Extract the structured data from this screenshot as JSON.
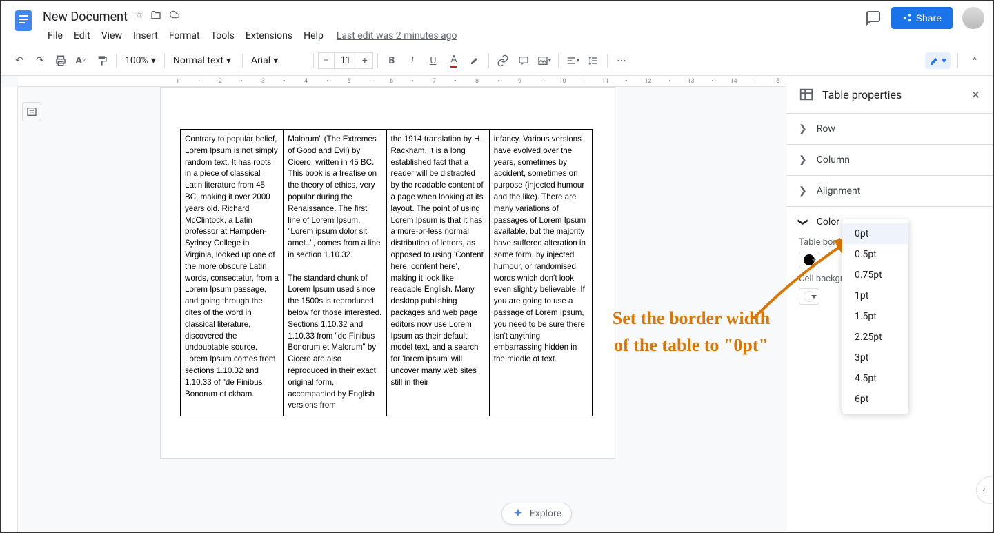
{
  "doc": {
    "title": "New Document"
  },
  "menus": [
    "File",
    "Edit",
    "View",
    "Insert",
    "Format",
    "Tools",
    "Extensions",
    "Help"
  ],
  "last_edit": "Last edit was 2 minutes ago",
  "share_label": "Share",
  "toolbar": {
    "zoom": "100%",
    "style": "Normal text",
    "font": "Arial",
    "fontsize": "11"
  },
  "table_cells": [
    "Contrary to popular belief, Lorem Ipsum is not simply random text. It has roots in a piece of classical Latin literature from 45 BC, making it over 2000 years old. Richard McClintock, a Latin professor at Hampden-Sydney College in Virginia, looked up one of the more obscure Latin words, consectetur, from a Lorem Ipsum passage, and going through the cites of the word in classical literature, discovered the undoubtable source. Lorem Ipsum comes from sections 1.10.32 and 1.10.33 of \"de Finibus Bonorum et ckham.",
    "Malorum\" (The Extremes of Good and Evil) by Cicero, written in 45 BC. This book is a treatise on the theory of ethics, very popular during the Renaissance. The first line of Lorem Ipsum, \"Lorem ipsum dolor sit amet..\", comes from a line in section 1.10.32.\n\nThe standard chunk of Lorem Ipsum used since the 1500s is reproduced below for those interested. Sections 1.10.32 and 1.10.33 from \"de Finibus Bonorum et Malorum\" by Cicero are also reproduced in their exact original form, accompanied by English versions from",
    "the 1914 translation by H. Rackham. It is a long established fact that a reader will be distracted by the readable content of a page when looking at its layout. The point of using Lorem Ipsum is that it has a more-or-less normal distribution of letters, as opposed to using 'Content here, content here', making it look like readable English. Many desktop publishing packages and web page editors now use Lorem Ipsum as their default model text, and a search for 'lorem ipsum' will uncover many web sites still in their",
    "infancy. Various versions have evolved over the years, sometimes by accident, sometimes on purpose (injected humour and the like). There are many variations of passages of Lorem Ipsum available, but the majority have suffered alteration in some form, by injected humour, or randomised words which don't look even slightly believable. If you are going to use a passage of Lorem Ipsum, you need to be sure there isn't anything embarrassing hidden in the middle of text."
  ],
  "sidebar": {
    "title": "Table properties",
    "sections": {
      "row": "Row",
      "column": "Column",
      "alignment": "Alignment",
      "color": "Color"
    },
    "table_border_label": "Table border",
    "cell_bg_label": "Cell background"
  },
  "border_width_options": [
    "0pt",
    "0.5pt",
    "0.75pt",
    "1pt",
    "1.5pt",
    "2.25pt",
    "3pt",
    "4.5pt",
    "6pt"
  ],
  "explore_label": "Explore",
  "annotation_text": "Set the border width of the table to \"0pt\"",
  "ruler_numbers": [
    "1",
    "2",
    "3",
    "4",
    "5",
    "6",
    "7",
    "8",
    "9",
    "10",
    "11",
    "12",
    "13",
    "14",
    "15"
  ]
}
